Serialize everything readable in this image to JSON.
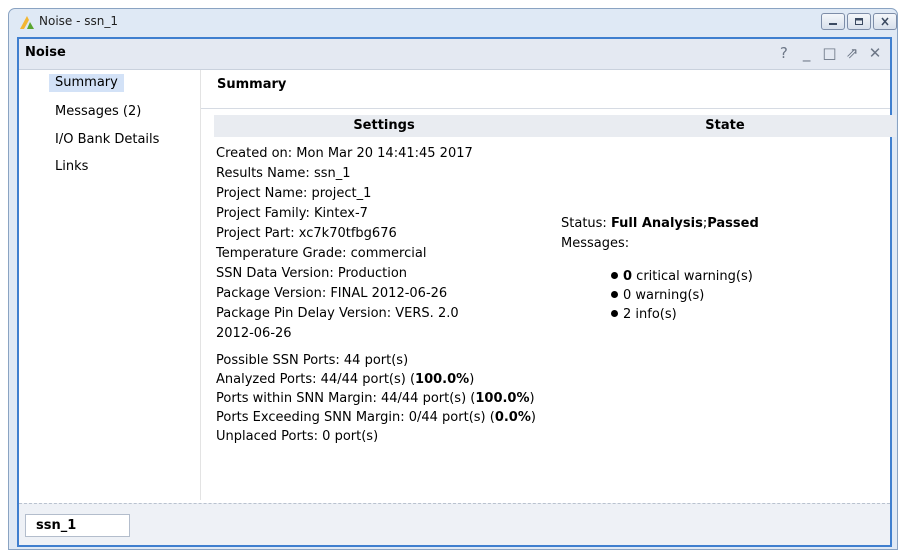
{
  "window": {
    "title": "Noise - ssn_1"
  },
  "panel": {
    "title": "Noise",
    "tools": {
      "help": "?",
      "minimize": "_",
      "maximize": "□",
      "restore": "⇗",
      "close": "✕"
    }
  },
  "nav": {
    "items": [
      "Summary",
      "Messages (2)",
      "I/O Bank Details",
      "Links"
    ],
    "selected": "Summary"
  },
  "summary": {
    "title": "Summary",
    "settings_header": "Settings",
    "state_header": "State",
    "settings_lines": [
      "Created on: Mon Mar 20 14:41:45 2017",
      "Results Name: ssn_1",
      "Project Name: project_1",
      "Project Family: Kintex-7",
      "Project Part: xc7k70tfbg676",
      "Temperature Grade: commercial",
      "SSN Data Version: Production",
      "Package Version: FINAL 2012-06-26",
      "Package Pin Delay Version: VERS. 2.0",
      "2012-06-26"
    ],
    "ports": {
      "possible": "Possible SSN Ports: 44 port(s)",
      "analyzed_prefix": "Analyzed Ports: 44/44 port(s) (",
      "analyzed_pct": "100.0%",
      "within_prefix": "Ports within SNN Margin: 44/44 port(s) (",
      "within_pct": "100.0%",
      "exceeding_prefix": "Ports Exceeding SNN Margin: 0/44 port(s) (",
      "exceeding_pct": "0.0%",
      "close_paren": ")",
      "unplaced": "Unplaced Ports: 0 port(s)"
    },
    "state": {
      "status_label": "Status: ",
      "status_value": "Full Analysis",
      "status_sep": ";",
      "status_result": "Passed",
      "messages_label": "Messages:",
      "critical_count": "0",
      "critical_text": " critical warning(s)",
      "warning_text": "0 warning(s)",
      "info_text": "2 info(s)"
    }
  },
  "bottom_tab": {
    "label": "ssn_1"
  },
  "colors": {
    "panel_border": "#3f7fcf",
    "selected_nav": "#d3e2f7",
    "header_bg": "#e9ecf1"
  }
}
